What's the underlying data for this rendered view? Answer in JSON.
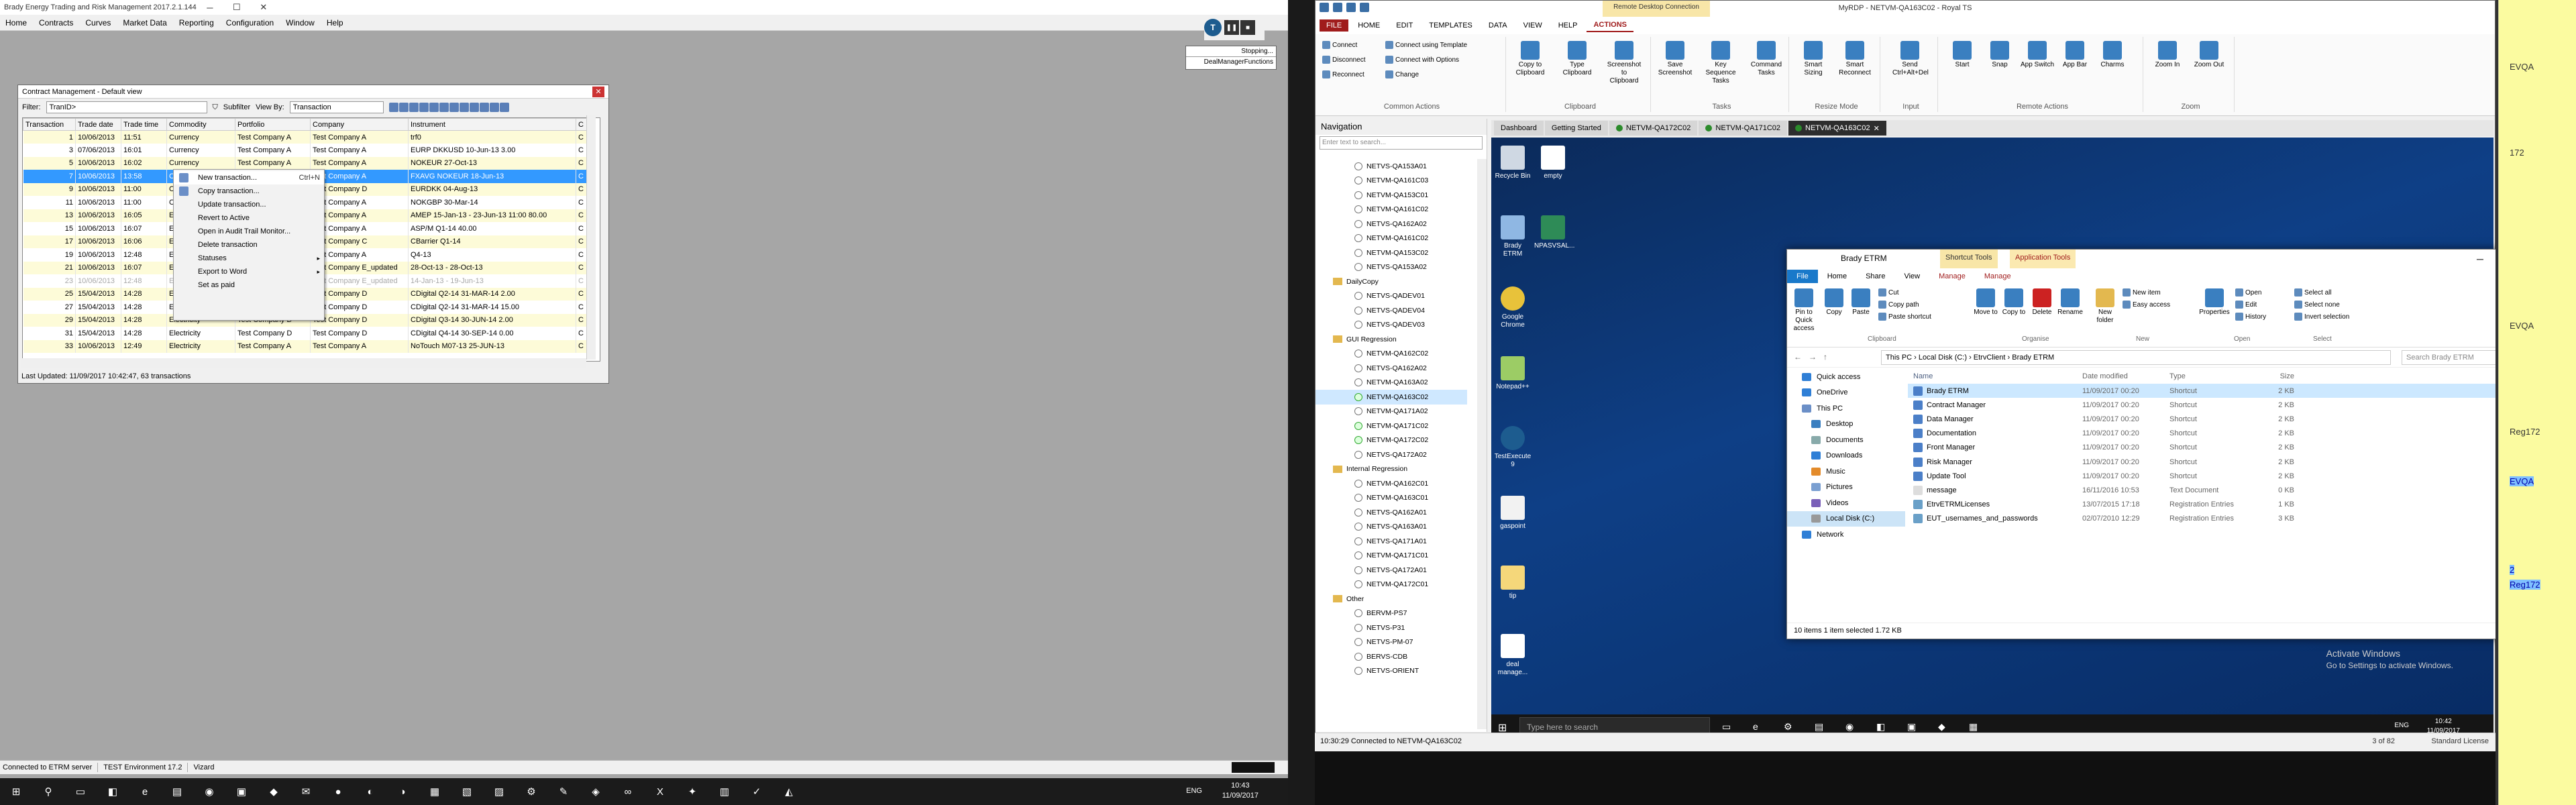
{
  "left": {
    "title": "Brady Energy Trading and Risk Management 2017.2.1.144",
    "menu": [
      "Home",
      "Contracts",
      "Curves",
      "Market Data",
      "Reporting",
      "Configuration",
      "Window",
      "Help"
    ],
    "deal_popup": {
      "item1": "Stopping...",
      "item2": "DealManagerFunctions"
    },
    "window": {
      "title": "Contract Management - Default view",
      "filter_label": "Filter:",
      "filter_value": "TranID>",
      "subfilter_label": "Subfilter",
      "viewby_label": "View By:",
      "viewby_value": "Transaction",
      "columns": [
        "Transaction",
        "Trade date",
        "Trade time",
        "Commodity",
        "Portfolio",
        "Company",
        "Instrument",
        "C"
      ],
      "rows": [
        {
          "id": "1",
          "date": "10/06/2013",
          "time": "11:51",
          "commodity": "Currency",
          "portfolio": "Test Company A",
          "company": "Test Company A",
          "instrument": "trf0",
          "c": "C",
          "style": "odd"
        },
        {
          "id": "3",
          "date": "07/06/2013",
          "time": "16:01",
          "commodity": "Currency",
          "portfolio": "Test Company A",
          "company": "Test Company A",
          "instrument": "EURP DKKUSD 10-Jun-13 3.00",
          "c": "C",
          "style": "even"
        },
        {
          "id": "5",
          "date": "10/06/2013",
          "time": "16:02",
          "commodity": "Currency",
          "portfolio": "Test Company A",
          "company": "Test Company A",
          "instrument": "NOKEUR 27-Oct-13",
          "c": "C",
          "style": "odd"
        },
        {
          "id": "7",
          "date": "10/06/2013",
          "time": "13:58",
          "commodity": "Currency",
          "portfolio": "Test Company A",
          "company": "Test Company A",
          "instrument": "FXAVG NOKEUR 18-Jun-13",
          "c": "C",
          "style": "sel"
        },
        {
          "id": "9",
          "date": "10/06/2013",
          "time": "11:00",
          "commodity": "Currency",
          "portfolio": "Test Company D",
          "company": "Test Company D",
          "instrument": "EURDKK 04-Aug-13",
          "c": "C",
          "style": "odd"
        },
        {
          "id": "11",
          "date": "10/06/2013",
          "time": "11:00",
          "commodity": "Currency",
          "portfolio": "Test Company A",
          "company": "Test Company A",
          "instrument": "NOKGBP 30-Mar-14",
          "c": "C",
          "style": "even"
        },
        {
          "id": "13",
          "date": "10/06/2013",
          "time": "16:05",
          "commodity": "Electricity",
          "portfolio": "Test Company A",
          "company": "Test Company A",
          "instrument": "AMEP 15-Jan-13 - 23-Jun-13 11:00 80.00",
          "c": "C",
          "style": "odd"
        },
        {
          "id": "15",
          "date": "10/06/2013",
          "time": "16:07",
          "commodity": "Electricity",
          "portfolio": "Test Company A",
          "company": "Test Company A",
          "instrument": "ASP/M Q1-14 40.00",
          "c": "C",
          "style": "even"
        },
        {
          "id": "17",
          "date": "10/06/2013",
          "time": "16:06",
          "commodity": "Electricity",
          "portfolio": "Test Company C",
          "company": "Test Company C",
          "instrument": "CBarrier Q1-14",
          "c": "C",
          "style": "odd"
        },
        {
          "id": "19",
          "date": "10/06/2013",
          "time": "12:48",
          "commodity": "Electricity",
          "portfolio": "Test Company A",
          "company": "Test Company A",
          "instrument": "Q4-13",
          "c": "C",
          "style": "even"
        },
        {
          "id": "21",
          "date": "10/06/2013",
          "time": "16:07",
          "commodity": "Electricity",
          "portfolio": "Test Company A",
          "company": "Test Company E_updated",
          "instrument": "28-Oct-13 - 28-Oct-13",
          "c": "C",
          "style": "odd"
        },
        {
          "id": "23",
          "date": "10/06/2013",
          "time": "12:48",
          "commodity": "Electricity",
          "portfolio": "Test Company A",
          "company": "Test Company E_updated",
          "instrument": "14-Jan-13 - 19-Jun-13",
          "c": "C",
          "style": "dim"
        },
        {
          "id": "25",
          "date": "15/04/2013",
          "time": "14:28",
          "commodity": "Electricity",
          "portfolio": "Test Company D",
          "company": "Test Company D",
          "instrument": "CDigital Q2-14 31-MAR-14 2.00",
          "c": "C",
          "style": "odd"
        },
        {
          "id": "27",
          "date": "15/04/2013",
          "time": "14:28",
          "commodity": "Electricity",
          "portfolio": "Test Company D",
          "company": "Test Company D",
          "instrument": "CDigital Q2-14 31-MAR-14 15.00",
          "c": "C",
          "style": "even"
        },
        {
          "id": "29",
          "date": "15/04/2013",
          "time": "14:28",
          "commodity": "Electricity",
          "portfolio": "Test Company D",
          "company": "Test Company D",
          "instrument": "CDigital Q3-14 30-JUN-14 2.00",
          "c": "C",
          "style": "odd"
        },
        {
          "id": "31",
          "date": "15/04/2013",
          "time": "14:28",
          "commodity": "Electricity",
          "portfolio": "Test Company D",
          "company": "Test Company D",
          "instrument": "CDigital Q4-14 30-SEP-14 0.00",
          "c": "C",
          "style": "even"
        },
        {
          "id": "33",
          "date": "10/06/2013",
          "time": "12:49",
          "commodity": "Electricity",
          "portfolio": "Test Company A",
          "company": "Test Company A",
          "instrument": "NoTouch M07-13 25-JUN-13",
          "c": "C",
          "style": "odd"
        }
      ],
      "status": "Last Updated: 11/09/2017 10:42:47, 63 transactions"
    },
    "context_menu": [
      {
        "label": "New transaction...",
        "shortcut": "Ctrl+N",
        "sub": ""
      },
      {
        "label": "Copy transaction...",
        "shortcut": "",
        "sub": ""
      },
      {
        "label": "Update transaction...",
        "shortcut": "",
        "sub": ""
      },
      {
        "label": "Revert to Active",
        "shortcut": "",
        "sub": ""
      },
      {
        "label": "Open in Audit Trail Monitor...",
        "shortcut": "",
        "sub": ""
      },
      {
        "label": "Delete transaction",
        "shortcut": "",
        "sub": ""
      },
      {
        "label": "Statuses",
        "shortcut": "",
        "sub": "▸"
      },
      {
        "label": "Export to Word",
        "shortcut": "",
        "sub": "▸"
      },
      {
        "label": "Set as paid",
        "shortcut": "",
        "sub": ""
      }
    ],
    "statusbar": [
      "Connected to ETRM server",
      "TEST Environment 17.2",
      "Vizard"
    ],
    "taskbar": {
      "lang": "ENG",
      "time": "10:43",
      "date": "11/09/2017"
    }
  },
  "right": {
    "title": "MyRDP - NETVM-QA163C02 - Royal TS",
    "context_tab": "Remote Desktop Connection",
    "ribbon_tabs": [
      "FILE",
      "HOME",
      "EDIT",
      "TEMPLATES",
      "DATA",
      "VIEW",
      "HELP",
      "ACTIONS"
    ],
    "ribbon_groups": [
      "Common Actions",
      "Clipboard",
      "Tasks",
      "Resize Mode",
      "Input",
      "Remote Actions",
      "Zoom"
    ],
    "common_actions": [
      "Connect",
      "Disconnect",
      "Reconnect",
      "Connect using Template",
      "Connect with Options",
      "Change"
    ],
    "clipboard": [
      "Copy to Clipboard",
      "Type Clipboard",
      "Screenshot to Clipboard"
    ],
    "tasks": [
      "Save Screenshot",
      "Key Sequence Tasks",
      "Command Tasks"
    ],
    "resize": [
      "Smart Sizing",
      "Smart Reconnect"
    ],
    "input": [
      "Send Ctrl+Alt+Del"
    ],
    "remote": [
      "Start",
      "Snap",
      "App Switch",
      "App Bar",
      "Charms"
    ],
    "zoom": [
      "Zoom In",
      "Zoom Out"
    ],
    "nav": {
      "title": "Navigation",
      "search_placeholder": "Enter text to search...",
      "items1": [
        "NETVS-QA153A01",
        "NETVM-QA161C03",
        "NETVM-QA153C01",
        "NETVM-QA161C02",
        "NETVS-QA162A02",
        "NETVM-QA161C02",
        "NETVM-QA153C02",
        "NETVS-QA153A02"
      ],
      "folder_daily": "DailyCopy",
      "items2": [
        "NETVS-QADEV01",
        "NETVS-QADEV04",
        "NETVS-QADEV03"
      ],
      "folder_gui": "GUI Regression",
      "items3": [
        "NETVM-QA162C02",
        "NETVS-QA162A02",
        "NETVM-QA163A02",
        "NETVM-QA163C02",
        "NETVM-QA171A02",
        "NETVM-QA171C02",
        "NETVM-QA172C02",
        "NETVS-QA172A02"
      ],
      "folder_internal": "Internal Regression",
      "items4": [
        "NETVM-QA162C01",
        "NETVM-QA163C01",
        "NETVS-QA162A01",
        "NETVS-QA163A01",
        "NETVS-QA171A01",
        "NETVM-QA171C01",
        "NETVS-QA172A01",
        "NETVM-QA172C01"
      ],
      "folder_other": "Other",
      "items5": [
        "BERVM-PS7",
        "NETVS-P31",
        "NETVS-PM-07",
        "BERVS-CDB",
        "NETVS-ORIENT"
      ]
    },
    "tabs": [
      "Dashboard",
      "Getting Started",
      "NETVM-QA172C02",
      "NETVM-QA171C02",
      "NETVM-QA163C02"
    ],
    "desktop_icons": [
      "Recycle Bin",
      "empty",
      "Brady ETRM",
      "NPASVSAL...",
      "Google Chrome",
      "Notepad++",
      "TestExecute 9",
      "gaspoint",
      "tip",
      "deal manage..."
    ],
    "explorer": {
      "title": "Brady ETRM",
      "ctx1": "Shortcut Tools",
      "ctx2": "Application Tools",
      "ctx_outer1": "Application Tools",
      "ctx_outer2": "TestExecute",
      "tabs": [
        "File",
        "Home",
        "Share",
        "View",
        "Manage",
        "Manage"
      ],
      "ribbon": [
        "Pin to Quick access",
        "Copy",
        "Paste",
        "Cut",
        "Copy path",
        "Paste shortcut",
        "Move to",
        "Copy to",
        "Delete",
        "Rename",
        "New folder",
        "New item",
        "Easy access",
        "Properties",
        "Open",
        "Edit",
        "History",
        "Select all",
        "Select none",
        "Invert selection"
      ],
      "ribbon_groups": [
        "Clipboard",
        "Organise",
        "New",
        "Open",
        "Select"
      ],
      "path": "This PC  ›  Local Disk (C:)  ›  EtrvClient  ›  Brady ETRM",
      "search_placeholder": "Search Brady ETRM",
      "side": [
        "Quick access",
        "OneDrive",
        "This PC",
        "Desktop",
        "Documents",
        "Downloads",
        "Music",
        "Pictures",
        "Videos",
        "Local Disk (C:)",
        "Network"
      ],
      "columns": [
        "Name",
        "Date modified",
        "Type",
        "Size"
      ],
      "files": [
        {
          "name": "Brady ETRM",
          "date": "11/09/2017 00:20",
          "type": "Shortcut",
          "size": "2 KB"
        },
        {
          "name": "Contract Manager",
          "date": "11/09/2017 00:20",
          "type": "Shortcut",
          "size": "2 KB"
        },
        {
          "name": "Data Manager",
          "date": "11/09/2017 00:20",
          "type": "Shortcut",
          "size": "2 KB"
        },
        {
          "name": "Documentation",
          "date": "11/09/2017 00:20",
          "type": "Shortcut",
          "size": "2 KB"
        },
        {
          "name": "Front Manager",
          "date": "11/09/2017 00:20",
          "type": "Shortcut",
          "size": "2 KB"
        },
        {
          "name": "Risk Manager",
          "date": "11/09/2017 00:20",
          "type": "Shortcut",
          "size": "2 KB"
        },
        {
          "name": "Update Tool",
          "date": "11/09/2017 00:20",
          "type": "Shortcut",
          "size": "2 KB"
        },
        {
          "name": "message",
          "date": "16/11/2016 10:53",
          "type": "Text Document",
          "size": "0 KB"
        },
        {
          "name": "EtrvETRMLicenses",
          "date": "13/07/2015 17:18",
          "type": "Registration Entries",
          "size": "1 KB"
        },
        {
          "name": "EUT_usernames_and_passwords",
          "date": "02/07/2010 12:29",
          "type": "Registration Entries",
          "size": "3 KB"
        }
      ],
      "status": "10 items     1 item selected  1.72 KB"
    },
    "activate": {
      "line1": "Activate Windows",
      "line2": "Go to Settings to activate Windows."
    },
    "rd_taskbar": {
      "search": "Type here to search",
      "lang": "ENG",
      "time": "10:42",
      "date": "11/09/2017"
    },
    "status": {
      "text": "10:30:29 Connected to NETVM-QA163C02",
      "pages": "3 of 82",
      "license": "Standard License"
    }
  },
  "sticky": [
    "EVQA",
    "172",
    "EVQA",
    "Reg172",
    "EVQA",
    "2",
    "Reg172"
  ]
}
